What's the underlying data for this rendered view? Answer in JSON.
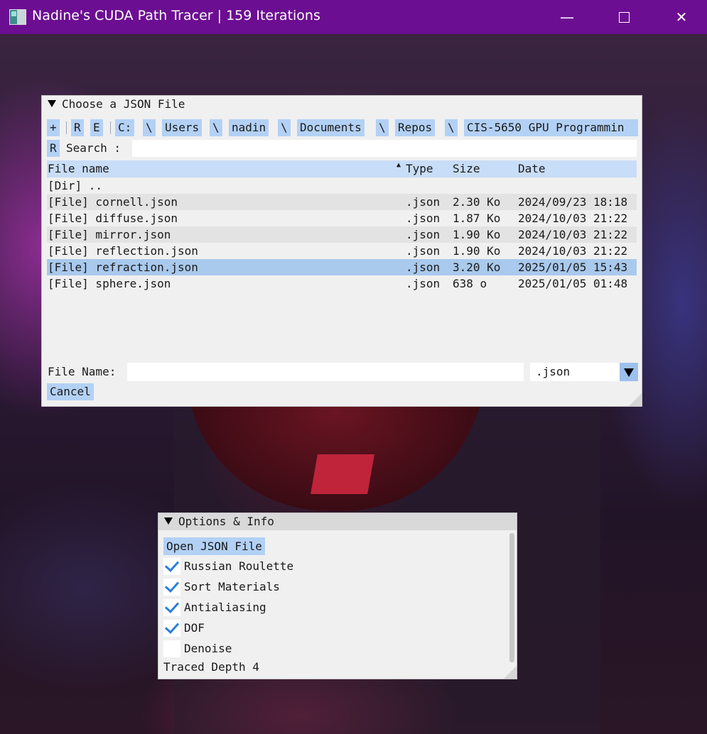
{
  "window": {
    "title": "Nadine's CUDA Path Tracer | 159 Iterations",
    "minimize": "—",
    "close": "✕"
  },
  "file_dialog": {
    "title": "Choose a JSON File",
    "breadcrumb": [
      "+",
      "R",
      "E",
      "C:",
      "\\",
      "Users",
      "\\",
      "nadin",
      "\\",
      "Documents",
      "\\",
      "Repos",
      "\\",
      "CIS-5650 GPU Programmin"
    ],
    "search_reset": "R",
    "search_label": "Search :",
    "columns": [
      "File name",
      "Type",
      "Size",
      "Date"
    ],
    "rows": [
      {
        "name": "[Dir] ..",
        "type": "",
        "size": "",
        "date": ""
      },
      {
        "name": "[File] cornell.json",
        "type": ".json",
        "size": "2.30 Ko",
        "date": "2024/09/23 18:18"
      },
      {
        "name": "[File] diffuse.json",
        "type": ".json",
        "size": "1.87 Ko",
        "date": "2024/10/03 21:22"
      },
      {
        "name": "[File] mirror.json",
        "type": ".json",
        "size": "1.90 Ko",
        "date": "2024/10/03 21:22"
      },
      {
        "name": "[File] reflection.json",
        "type": ".json",
        "size": "1.90 Ko",
        "date": "2024/10/03 21:22"
      },
      {
        "name": "[File] refraction.json",
        "type": ".json",
        "size": "3.20 Ko",
        "date": "2025/01/05 15:43"
      },
      {
        "name": "[File] sphere.json",
        "type": ".json",
        "size": "638 o",
        "date": "2025/01/05 01:48"
      }
    ],
    "selected_row": 5,
    "file_name_label": "File Name:",
    "file_name_value": "",
    "filter": ".json",
    "cancel_label": "Cancel"
  },
  "options": {
    "title": "Options & Info",
    "open_button": "Open JSON File",
    "checkboxes": [
      {
        "label": "Russian Roulette",
        "checked": true
      },
      {
        "label": "Sort Materials",
        "checked": true
      },
      {
        "label": "Antialiasing",
        "checked": true
      },
      {
        "label": "DOF",
        "checked": true
      },
      {
        "label": "Denoise",
        "checked": false
      }
    ],
    "traced_depth": "Traced Depth 4"
  }
}
